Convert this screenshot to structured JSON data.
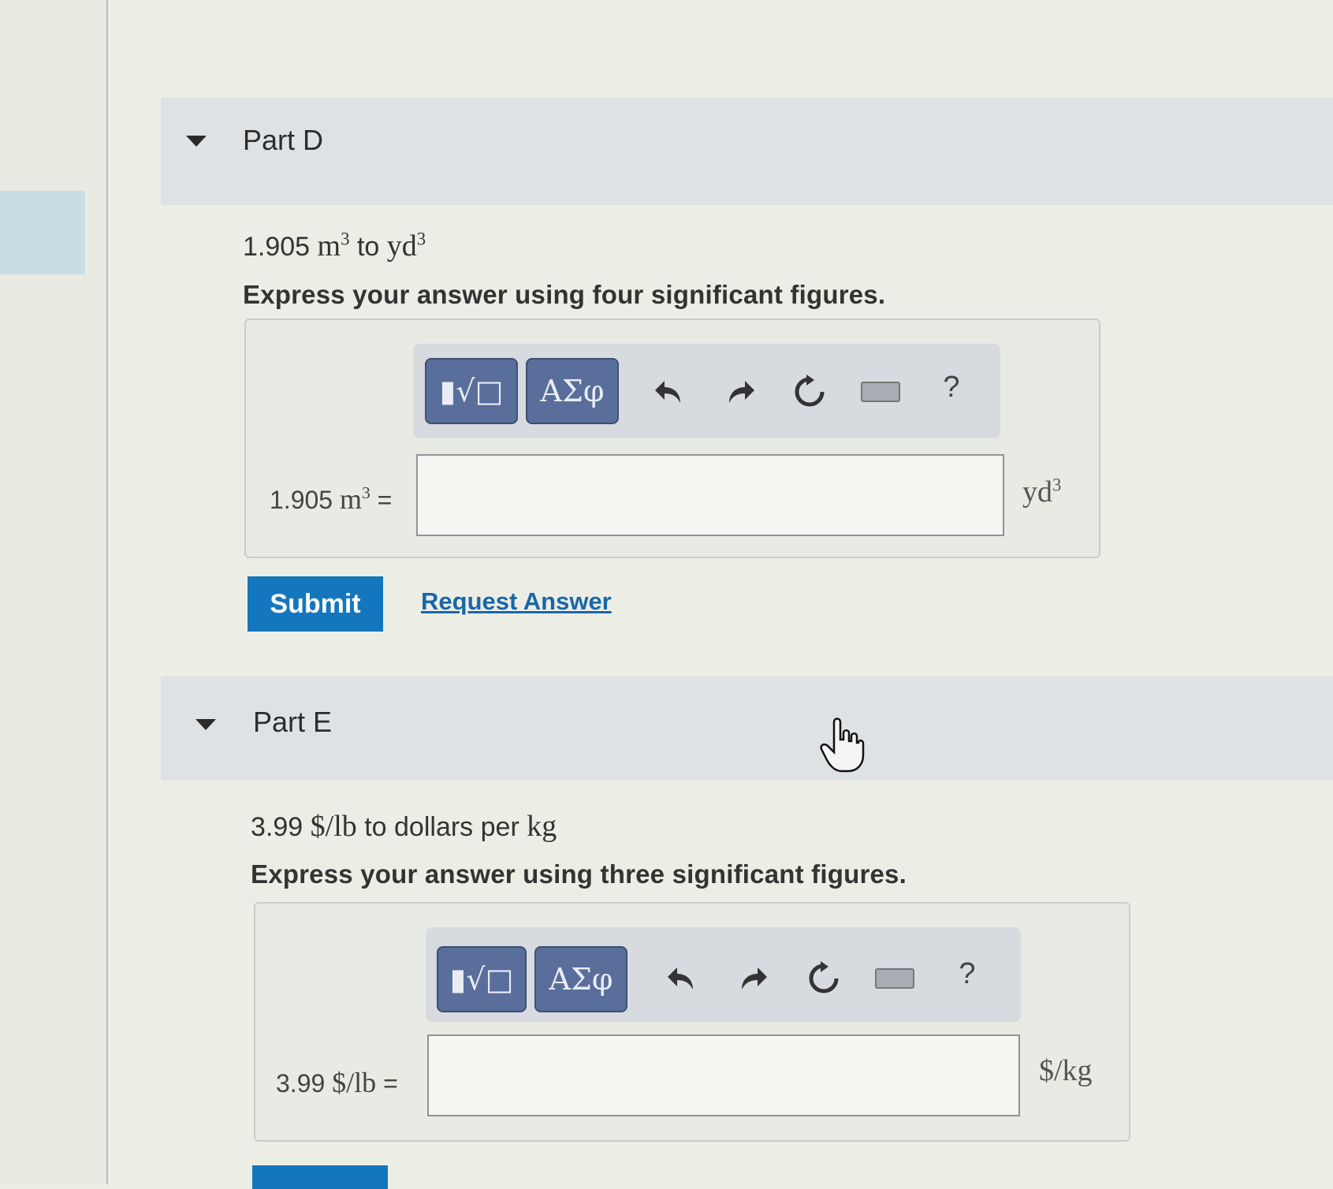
{
  "partD": {
    "title": "Part D",
    "prompt_value": "1.905",
    "prompt_from": "m",
    "prompt_exp1": "3",
    "prompt_to_word": "to",
    "prompt_to": "yd",
    "prompt_exp2": "3",
    "instruction": "Express your answer using four significant figures.",
    "eq_value": "1.905",
    "eq_unit": "m",
    "eq_exp": "3",
    "eq_sign": "=",
    "input_value": "",
    "result_unit": "yd",
    "result_exp": "3",
    "submit_label": "Submit",
    "request_label": "Request Answer"
  },
  "partE": {
    "title": "Part E",
    "prompt_value": "3.99",
    "prompt_from": "$/lb",
    "prompt_to_text": "to dollars per",
    "prompt_to": "kg",
    "instruction": "Express your answer using three significant figures.",
    "eq_value": "3.99",
    "eq_unit": "$/lb",
    "eq_sign": "=",
    "input_value": "",
    "result_unit": "$/kg"
  },
  "toolbar": {
    "templates_label": "▮√□",
    "greek_label": "ΑΣφ",
    "undo_icon": "undo-icon",
    "redo_icon": "redo-icon",
    "reset_icon": "reset-icon",
    "keyboard_icon": "keyboard-icon",
    "help_label": "?"
  },
  "colors": {
    "submit_bg": "#1477be",
    "link": "#1a67a8",
    "toolbar_btn": "#596e9a",
    "header_bg": "#dfe2e4"
  }
}
